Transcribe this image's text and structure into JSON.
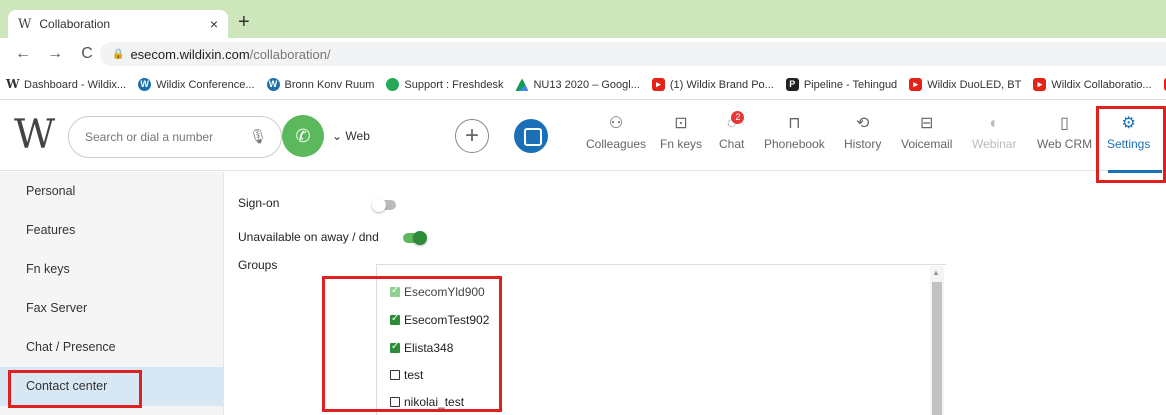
{
  "browser": {
    "tab_title": "Collaboration",
    "tab_close": "×",
    "new_tab": "+",
    "url_host": "esecom.wildixin.com",
    "url_path": "/collaboration/",
    "bookmarks": [
      {
        "label": "Dashboard - Wildix...",
        "icon": "wildix-icon"
      },
      {
        "label": "Wildix Conference...",
        "icon": "wordpress-icon"
      },
      {
        "label": "Bronn Konv Ruum",
        "icon": "wordpress-icon"
      },
      {
        "label": "Support : Freshdesk",
        "icon": "freshdesk-icon"
      },
      {
        "label": "NU13 2020 – Googl...",
        "icon": "google-drive-icon"
      },
      {
        "label": "(1) Wildix Brand Po...",
        "icon": "youtube-icon"
      },
      {
        "label": "Pipeline - Tehingud",
        "icon": "pipedrive-icon"
      },
      {
        "label": "Wildix DuoLED, BT",
        "icon": "youtube-icon"
      },
      {
        "label": "Wildix Collaboratio...",
        "icon": "youtube-icon"
      }
    ]
  },
  "header": {
    "logo": "W",
    "search_placeholder": "Search or dial a number",
    "web_label": "Web",
    "nav": [
      {
        "label": "Colleagues",
        "icon": "colleagues-icon"
      },
      {
        "label": "Fn keys",
        "icon": "fn-keys-icon"
      },
      {
        "label": "Chat",
        "icon": "chat-icon",
        "badge": "2"
      },
      {
        "label": "Phonebook",
        "icon": "phonebook-icon"
      },
      {
        "label": "History",
        "icon": "history-icon"
      },
      {
        "label": "Voicemail",
        "icon": "voicemail-icon"
      },
      {
        "label": "Webinar",
        "icon": "webinar-icon"
      },
      {
        "label": "Web CRM",
        "icon": "web-crm-icon"
      },
      {
        "label": "Settings",
        "icon": "settings-icon"
      }
    ]
  },
  "sidebar": {
    "items": [
      {
        "label": "Personal"
      },
      {
        "label": "Features"
      },
      {
        "label": "Fn keys"
      },
      {
        "label": "Fax Server"
      },
      {
        "label": "Chat / Presence"
      },
      {
        "label": "Contact center",
        "active": true
      }
    ]
  },
  "content": {
    "sign_on_label": "Sign-on",
    "sign_on": false,
    "unavailable_label": "Unavailable on away / dnd",
    "unavailable": true,
    "groups_label": "Groups",
    "groups": [
      {
        "name": "EsecomYld900",
        "checked": true,
        "disabled": true
      },
      {
        "name": "EsecomTest902",
        "checked": true
      },
      {
        "name": "Elista348",
        "checked": true
      },
      {
        "name": "test",
        "checked": false
      },
      {
        "name": "nikolai_test",
        "checked": false
      }
    ]
  },
  "colors": {
    "accent": "#1a6fb6",
    "green": "#5cb85c",
    "highlight_red": "#e01f1f"
  }
}
